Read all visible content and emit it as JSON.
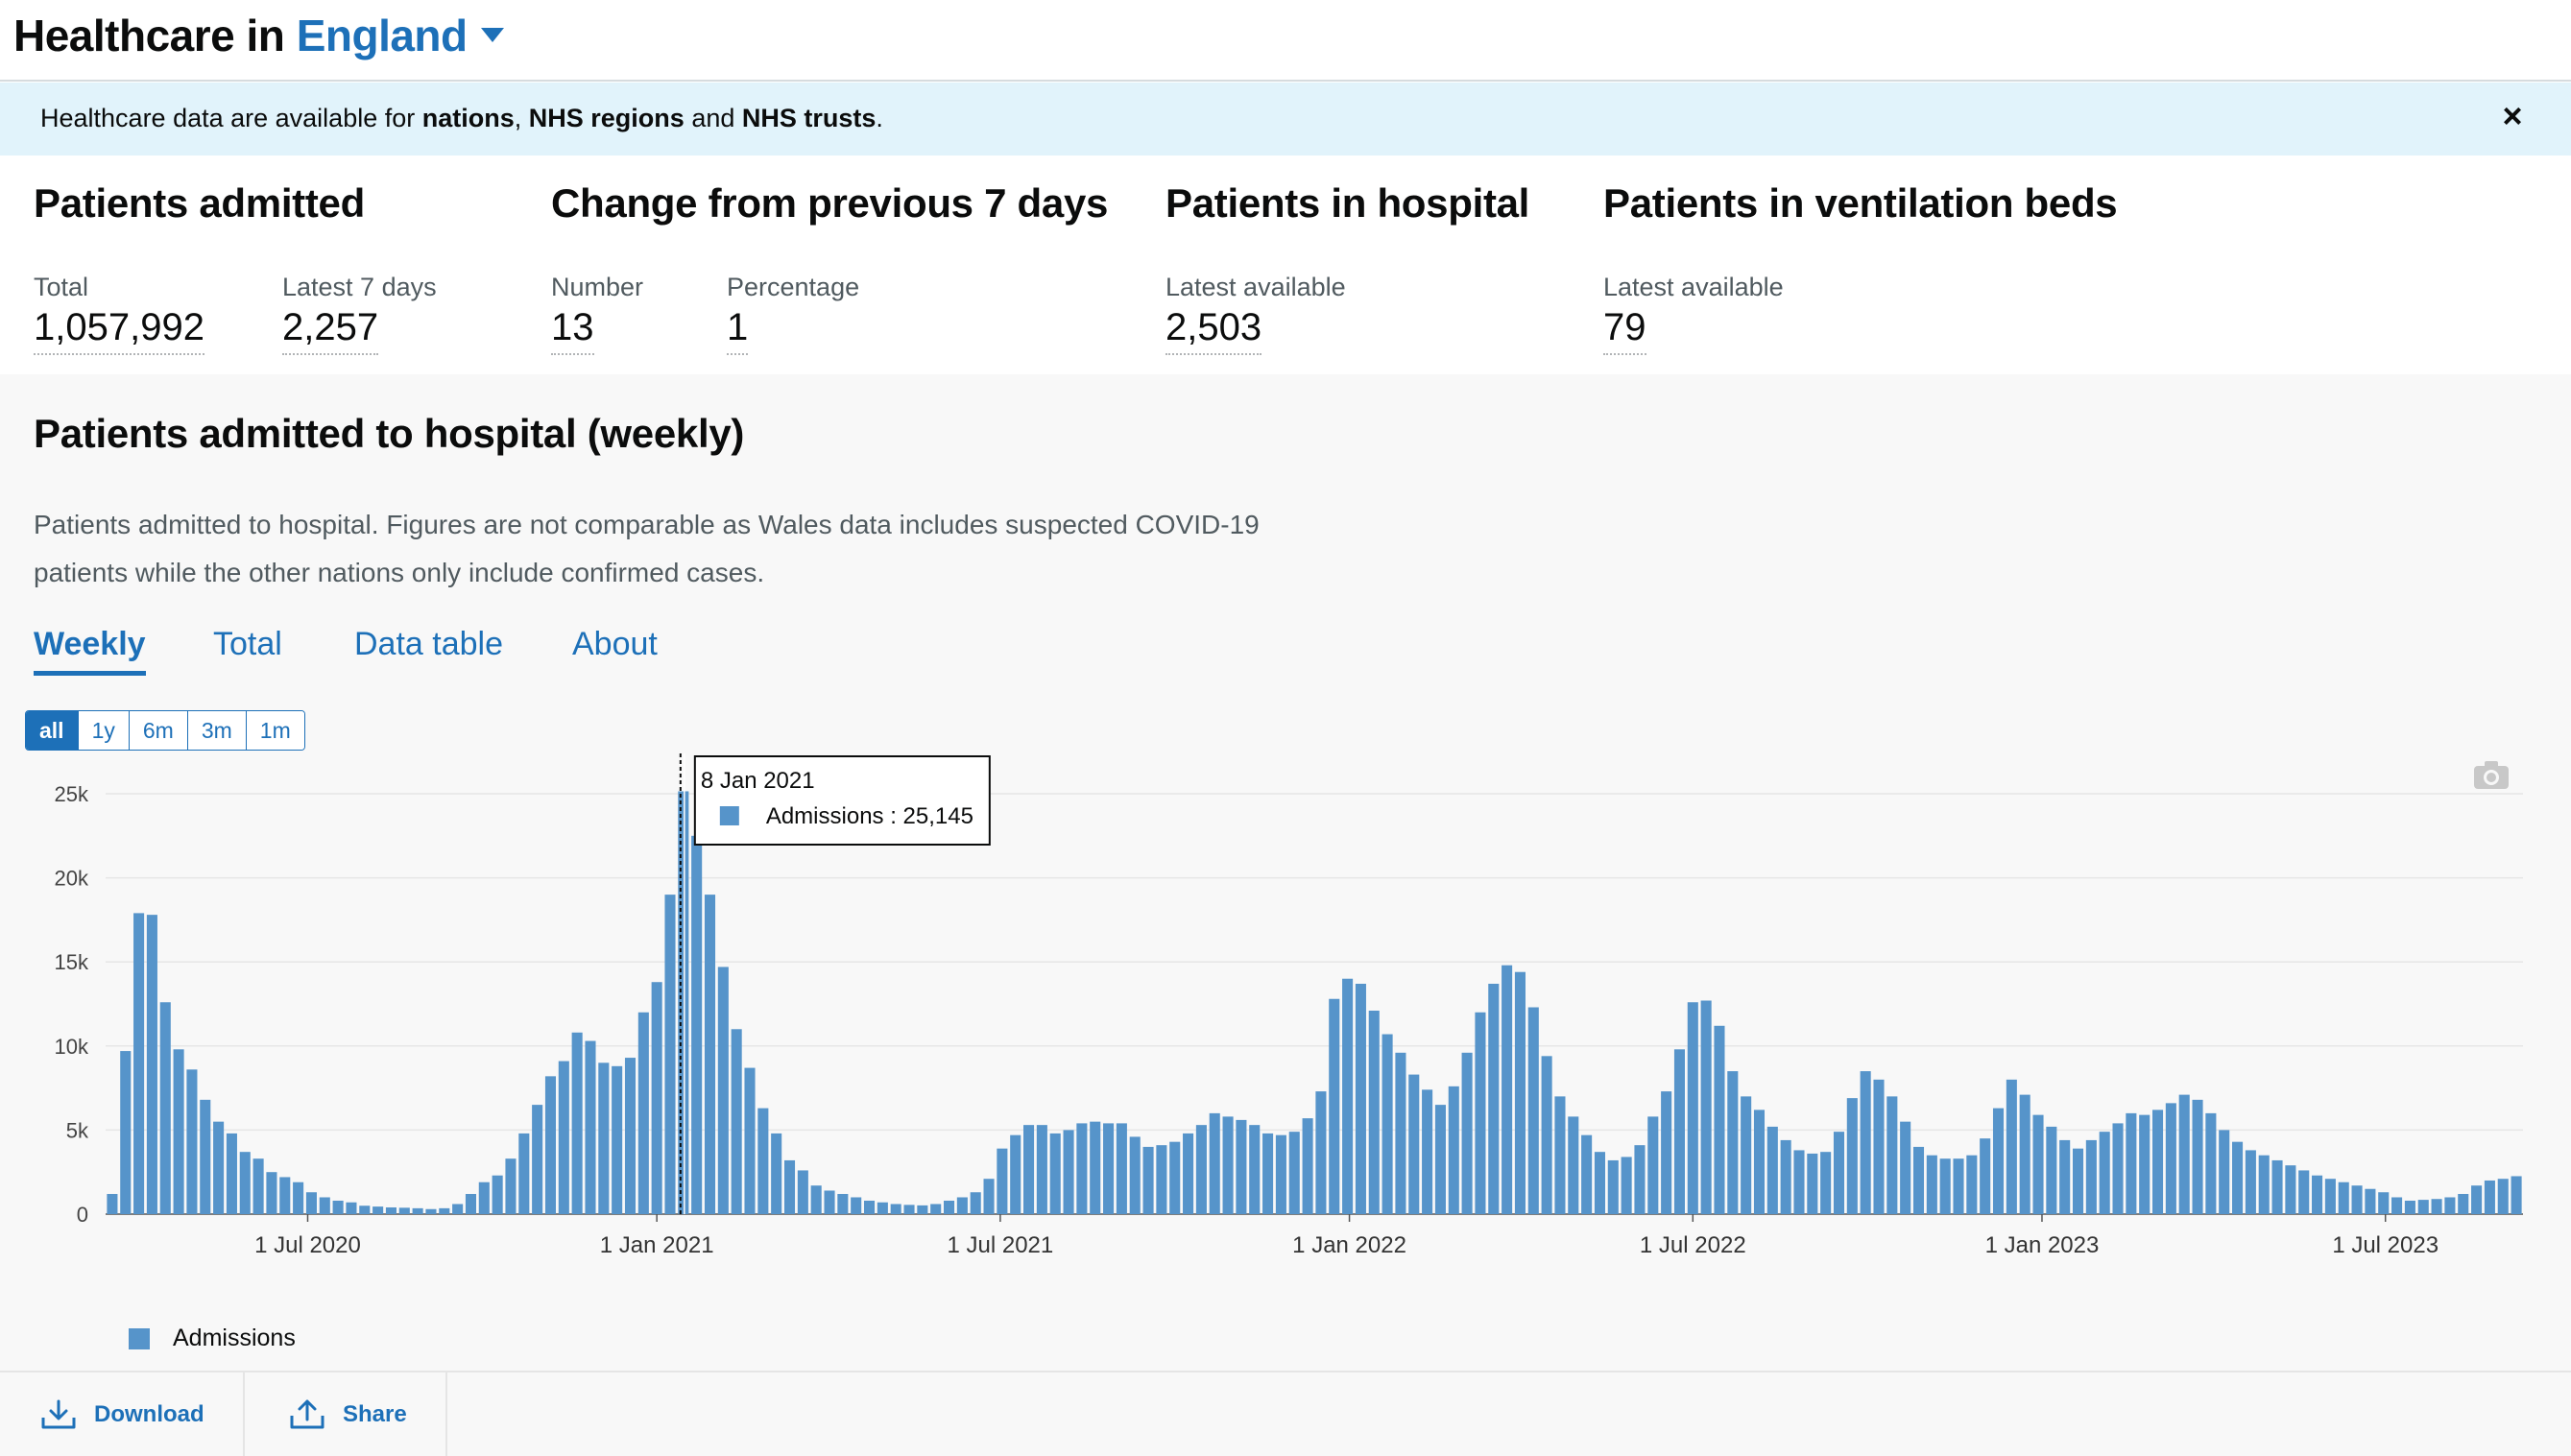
{
  "header": {
    "title_prefix": "Healthcare in",
    "area": "England"
  },
  "banner": {
    "text_a": "Healthcare data are available for ",
    "nations": "nations",
    "sep1": ", ",
    "regions": "NHS regions",
    "sep2": " and ",
    "trusts": "NHS trusts",
    "end": ".",
    "close": "×"
  },
  "headlines": {
    "admitted": {
      "title": "Patients admitted",
      "total_label": "Total",
      "total_value": "1,057,992",
      "latest_label": "Latest 7 days",
      "latest_value": "2,257"
    },
    "change": {
      "title": "Change from previous 7 days",
      "number_label": "Number",
      "number_value": "13",
      "percent_label": "Percentage",
      "percent_value": "1"
    },
    "in_hospital": {
      "title": "Patients in hospital",
      "label": "Latest available",
      "value": "2,503"
    },
    "ventilation": {
      "title": "Patients in ventilation beds",
      "label": "Latest available",
      "value": "79"
    }
  },
  "card": {
    "title": "Patients admitted to hospital (weekly)",
    "description": "Patients admitted to hospital. Figures are not comparable as Wales data includes suspected COVID-19 patients while the other nations only include confirmed cases.",
    "tabs": [
      {
        "label": "Weekly",
        "active": true
      },
      {
        "label": "Total",
        "active": false
      },
      {
        "label": "Data table",
        "active": false
      },
      {
        "label": "About",
        "active": false
      }
    ],
    "range_buttons": [
      "all",
      "1y",
      "6m",
      "3m",
      "1m"
    ],
    "range_active": "all",
    "legend_label": "Admissions",
    "download_label": "Download",
    "share_label": "Share"
  },
  "colors": {
    "accent": "#1d70b8",
    "bar": "#5694ca",
    "banner_bg": "#e1f3fb"
  },
  "icons": [
    "caret-down-icon",
    "close-icon",
    "camera-icon",
    "download-icon",
    "share-icon"
  ],
  "chart_data": {
    "type": "bar",
    "series": [
      {
        "name": "Admissions"
      }
    ],
    "x_start": "2020-03-20",
    "x_interval_days": 7,
    "values": [
      1200,
      9700,
      17900,
      17800,
      12600,
      9800,
      8600,
      6800,
      5500,
      4800,
      3700,
      3300,
      2500,
      2200,
      1900,
      1300,
      1000,
      800,
      700,
      500,
      450,
      400,
      380,
      350,
      300,
      350,
      600,
      1200,
      1900,
      2300,
      3300,
      4800,
      6500,
      8200,
      9100,
      10800,
      10300,
      9000,
      8800,
      9300,
      12000,
      13800,
      19000,
      25145,
      22500,
      19000,
      14700,
      11000,
      8700,
      6300,
      4800,
      3200,
      2600,
      1700,
      1400,
      1200,
      1000,
      800,
      700,
      600,
      550,
      520,
      600,
      800,
      1000,
      1300,
      2100,
      3900,
      4700,
      5300,
      5300,
      4800,
      5000,
      5400,
      5500,
      5400,
      5400,
      4600,
      4000,
      4100,
      4300,
      4800,
      5300,
      6000,
      5800,
      5600,
      5300,
      4800,
      4700,
      4900,
      5700,
      7300,
      12800,
      14000,
      13700,
      12100,
      10700,
      9600,
      8300,
      7400,
      6500,
      7600,
      9600,
      12000,
      13700,
      14800,
      14400,
      12300,
      9400,
      7000,
      5800,
      4700,
      3700,
      3200,
      3400,
      4100,
      5800,
      7300,
      9800,
      12600,
      12700,
      11200,
      8500,
      7000,
      6200,
      5200,
      4400,
      3800,
      3600,
      3700,
      4900,
      6900,
      8500,
      8000,
      7000,
      5500,
      4000,
      3500,
      3300,
      3300,
      3500,
      4500,
      6300,
      8000,
      7100,
      5900,
      5200,
      4400,
      3900,
      4400,
      4900,
      5400,
      6000,
      5900,
      6200,
      6600,
      7100,
      6800,
      6000,
      5000,
      4300,
      3800,
      3500,
      3200,
      2900,
      2600,
      2300,
      2100,
      1900,
      1700,
      1500,
      1300,
      1000,
      800,
      850,
      900,
      1000,
      1200,
      1700,
      2000,
      2100,
      2257
    ],
    "y_ticks": [
      "0",
      "5k",
      "10k",
      "15k",
      "20k",
      "25k"
    ],
    "y_max": 25000,
    "x_ticks": [
      {
        "label": "1 Jul 2020",
        "date": "2020-07-01"
      },
      {
        "label": "1 Jan 2021",
        "date": "2021-01-01"
      },
      {
        "label": "1 Jul 2021",
        "date": "2021-07-01"
      },
      {
        "label": "1 Jan 2022",
        "date": "2022-01-01"
      },
      {
        "label": "1 Jul 2022",
        "date": "2022-07-01"
      },
      {
        "label": "1 Jan 2023",
        "date": "2023-01-01"
      },
      {
        "label": "1 Jul 2023",
        "date": "2023-07-01"
      }
    ],
    "tooltip": {
      "date": "8 Jan 2021",
      "index": 43,
      "series": "Admissions",
      "value_text": "25,145"
    },
    "grid": true,
    "legend": "bottom-left"
  }
}
